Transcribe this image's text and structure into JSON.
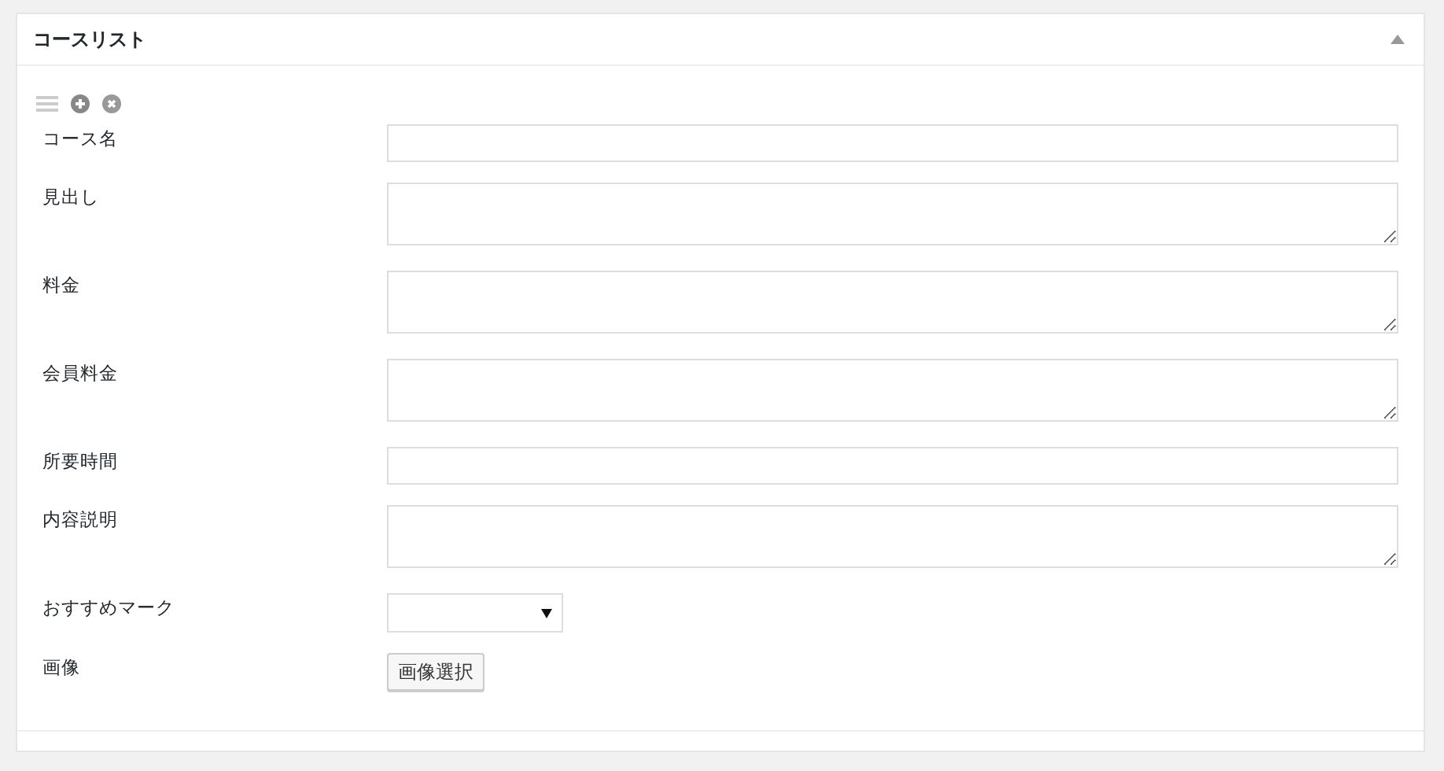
{
  "panel": {
    "title": "コースリスト",
    "expanded": true
  },
  "fields": [
    {
      "label": "コース名",
      "kind": "text"
    },
    {
      "label": "見出し",
      "kind": "textarea"
    },
    {
      "label": "料金",
      "kind": "textarea"
    },
    {
      "label": "会員料金",
      "kind": "textarea"
    },
    {
      "label": "所要時間",
      "kind": "text"
    },
    {
      "label": "内容説明",
      "kind": "textarea"
    },
    {
      "label": "おすすめマーク",
      "kind": "select"
    },
    {
      "label": "画像",
      "kind": "button",
      "button": "画像選択"
    }
  ]
}
